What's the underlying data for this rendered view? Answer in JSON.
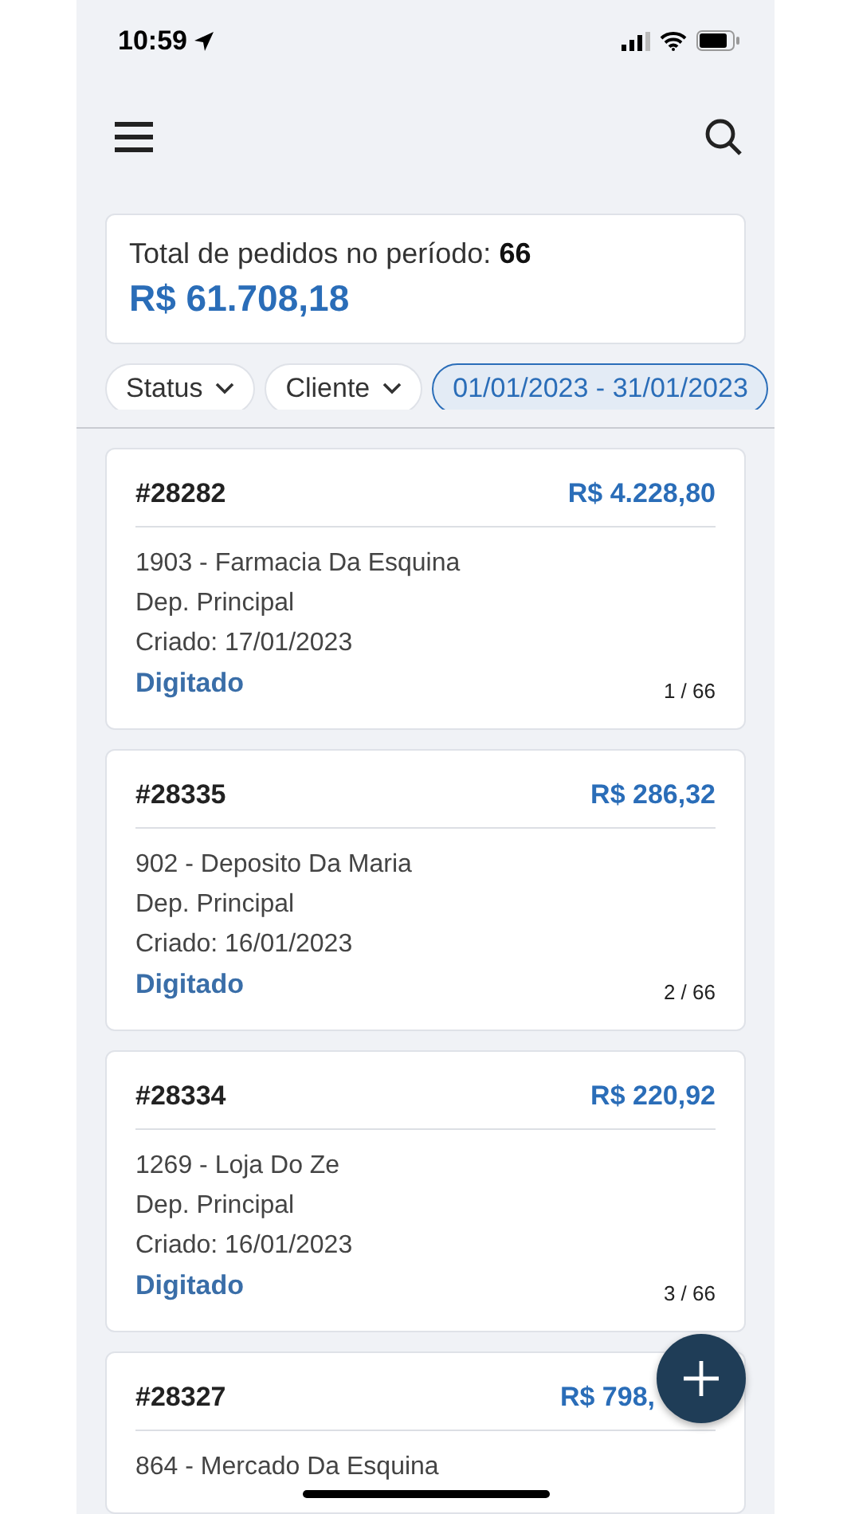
{
  "status_bar": {
    "time": "10:59"
  },
  "summary": {
    "label": "Total de pedidos no período:",
    "count": "66",
    "total": "R$ 61.708,18"
  },
  "filters": [
    {
      "label": "Status",
      "kind": "dropdown",
      "selected": false
    },
    {
      "label": "Cliente",
      "kind": "dropdown",
      "selected": false
    },
    {
      "label": "01/01/2023 - 31/01/2023",
      "kind": "range",
      "selected": true
    }
  ],
  "orders": [
    {
      "number": "#28282",
      "amount": "R$ 4.228,80",
      "customer": "1903 - Farmacia Da Esquina",
      "warehouse": "Dep. Principal",
      "created": "Criado: 17/01/2023",
      "status": "Digitado",
      "position": "1 / 66"
    },
    {
      "number": "#28335",
      "amount": "R$ 286,32",
      "customer": "902 - Deposito Da Maria",
      "warehouse": "Dep. Principal",
      "created": "Criado: 16/01/2023",
      "status": "Digitado",
      "position": "2 / 66"
    },
    {
      "number": "#28334",
      "amount": "R$ 220,92",
      "customer": "1269 - Loja Do Ze",
      "warehouse": "Dep. Principal",
      "created": "Criado: 16/01/2023",
      "status": "Digitado",
      "position": "3 / 66"
    },
    {
      "number": "#28327",
      "amount": "R$ 798,",
      "customer": "864 - Mercado Da Esquina"
    }
  ]
}
